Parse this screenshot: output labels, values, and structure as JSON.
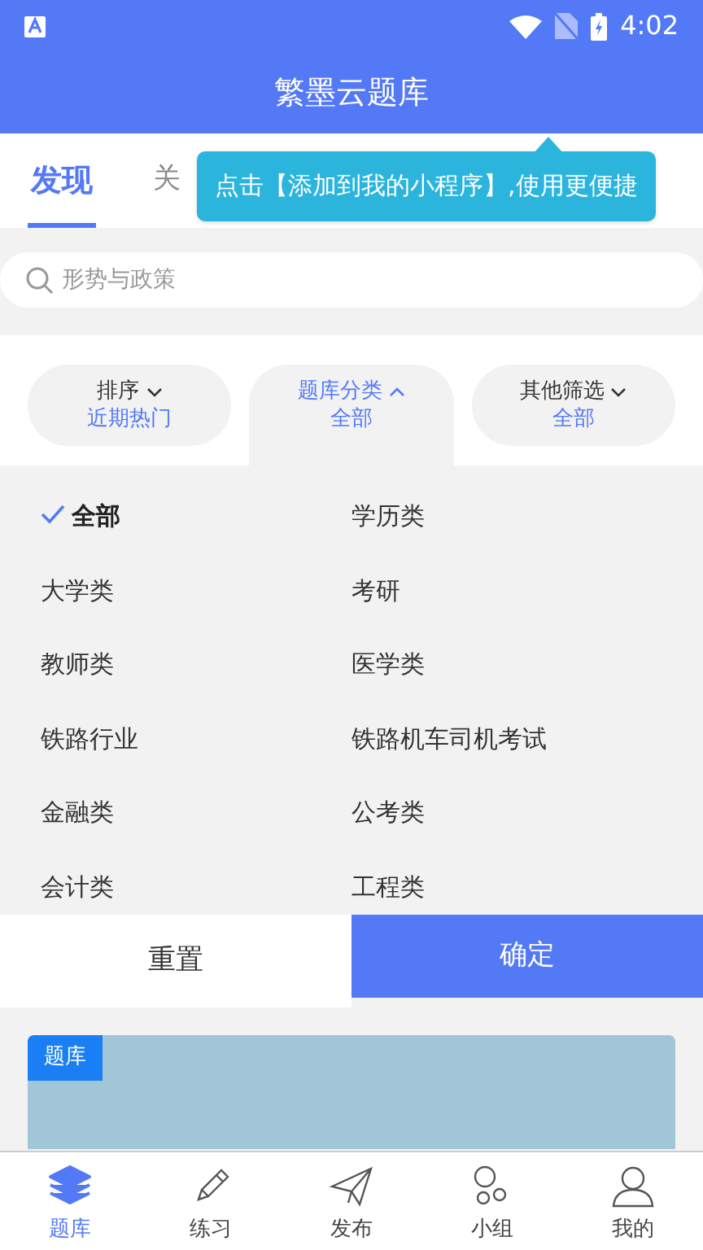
{
  "status_bar": {
    "time": "4:02"
  },
  "app_bar": {
    "title": "繁墨云题库"
  },
  "tabs": [
    {
      "label": "发现",
      "selected": true
    },
    {
      "label": "关",
      "selected": false
    }
  ],
  "tooltip": {
    "text": "点击【添加到我的小程序】,使用更便捷"
  },
  "search": {
    "placeholder": "形势与政策"
  },
  "filters": [
    {
      "label": "排序",
      "value": "近期热门",
      "expanded": false
    },
    {
      "label": "题库分类",
      "value": "全部",
      "expanded": true
    },
    {
      "label": "其他筛选",
      "value": "全部",
      "expanded": false
    }
  ],
  "options": [
    {
      "label": "全部",
      "selected": true
    },
    {
      "label": "学历类",
      "selected": false
    },
    {
      "label": "大学类",
      "selected": false
    },
    {
      "label": "考研",
      "selected": false
    },
    {
      "label": "教师类",
      "selected": false
    },
    {
      "label": "医学类",
      "selected": false
    },
    {
      "label": "铁路行业",
      "selected": false
    },
    {
      "label": "铁路机车司机考试",
      "selected": false
    },
    {
      "label": "金融类",
      "selected": false
    },
    {
      "label": "公考类",
      "selected": false
    },
    {
      "label": "会计类",
      "selected": false
    },
    {
      "label": "工程类",
      "selected": false
    }
  ],
  "actions": [
    {
      "label": "重置",
      "kind": "secondary"
    },
    {
      "label": "确定",
      "kind": "primary"
    }
  ],
  "card": {
    "tag": "题库"
  },
  "bottom_nav": [
    {
      "label": "题库",
      "selected": true
    },
    {
      "label": "练习",
      "selected": false
    },
    {
      "label": "发布",
      "selected": false
    },
    {
      "label": "小组",
      "selected": false
    },
    {
      "label": "我的",
      "selected": false
    }
  ]
}
